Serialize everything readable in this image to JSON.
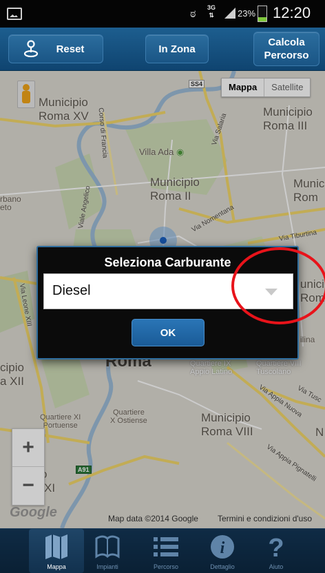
{
  "status_bar": {
    "network_type": "3G",
    "battery_percent": "23%",
    "time": "12:20",
    "icons": [
      "gallery-icon",
      "eye-icon",
      "signal-icon",
      "battery-icon"
    ]
  },
  "toolbar": {
    "reset_label": "Reset",
    "in_zona_label": "In Zona",
    "calcola_line1": "Calcola",
    "calcola_line2": "Percorso"
  },
  "map": {
    "map_type": {
      "active": "Mappa",
      "inactive": "Satellite"
    },
    "labels": {
      "municipio_xv_1": "Municipio",
      "municipio_xv_2": "Roma XV",
      "municipio_iii_1": "Municipio",
      "municipio_iii_2": "Roma III",
      "villa_ada": "Villa Ada",
      "municipio_ii_1": "Municipio",
      "municipio_ii_2": "Roma II",
      "muni_right_1": "Munic",
      "muni_right_2": "Rom",
      "urbano": "rbano",
      "eto": "eto",
      "roma": "Roma",
      "municipio_viii_1": "Municipio",
      "municipio_viii_2": "Roma VIII",
      "quartiere_xi_1": "Quartiere XI",
      "quartiere_xi_2": "Portuense",
      "quartiere_ostiense_1": "Quartiere",
      "quartiere_ostiense_2": "X Ostiense",
      "quartiere_ix_1": "Quartiere IX",
      "quartiere_ix_2": "Appio Latino",
      "quartiere_viii_1": "Quartiere VIII",
      "quartiere_viii_2": "Tuscolano",
      "cipio": "cipio",
      "a_xii": "a XII",
      "ipio": "ipio",
      "xi": "XI",
      "unici": "unici",
      "roma_right": "Roma",
      "silina": "ilina",
      "via_salaria": "Via Salaria",
      "corso_di_francia": "Corso di Francia",
      "viale_angelico": "Viale Angelico",
      "via_nomentana": "Via Nomentana",
      "via_tiburtina": "Via Tiburtina",
      "via_leone_xiii": "Via Leone XIII",
      "via_appia_nuova": "Via Appia Nuova",
      "via_tusc": "Via Tusc",
      "via_appia_pignatelli": "Via Appia Pignatelli",
      "ss4": "SS4",
      "a91": "A91",
      "n_right": "N"
    },
    "google_logo": "Google",
    "attribution": "Map data ©2014 Google",
    "terms": "Termini e condizioni d'uso",
    "zoom_in": "+",
    "zoom_out": "−"
  },
  "dialog": {
    "title": "Seleziona Carburante",
    "selected_value": "Diesel",
    "ok_label": "OK"
  },
  "bottom_nav": {
    "items": [
      {
        "label": "Mappa",
        "icon": "map-icon",
        "active": true
      },
      {
        "label": "Impianti",
        "icon": "book-icon",
        "active": false
      },
      {
        "label": "Percorso",
        "icon": "list-icon",
        "active": false
      },
      {
        "label": "Dettaglio",
        "icon": "info-icon",
        "active": false
      },
      {
        "label": "Aiuto",
        "icon": "help-icon",
        "active": false
      }
    ]
  },
  "colors": {
    "toolbar": "#1d5e8f",
    "bottom_nav": "#0f2b45",
    "annotation_circle": "#e8131a",
    "dialog_border": "#2f6e9f"
  }
}
